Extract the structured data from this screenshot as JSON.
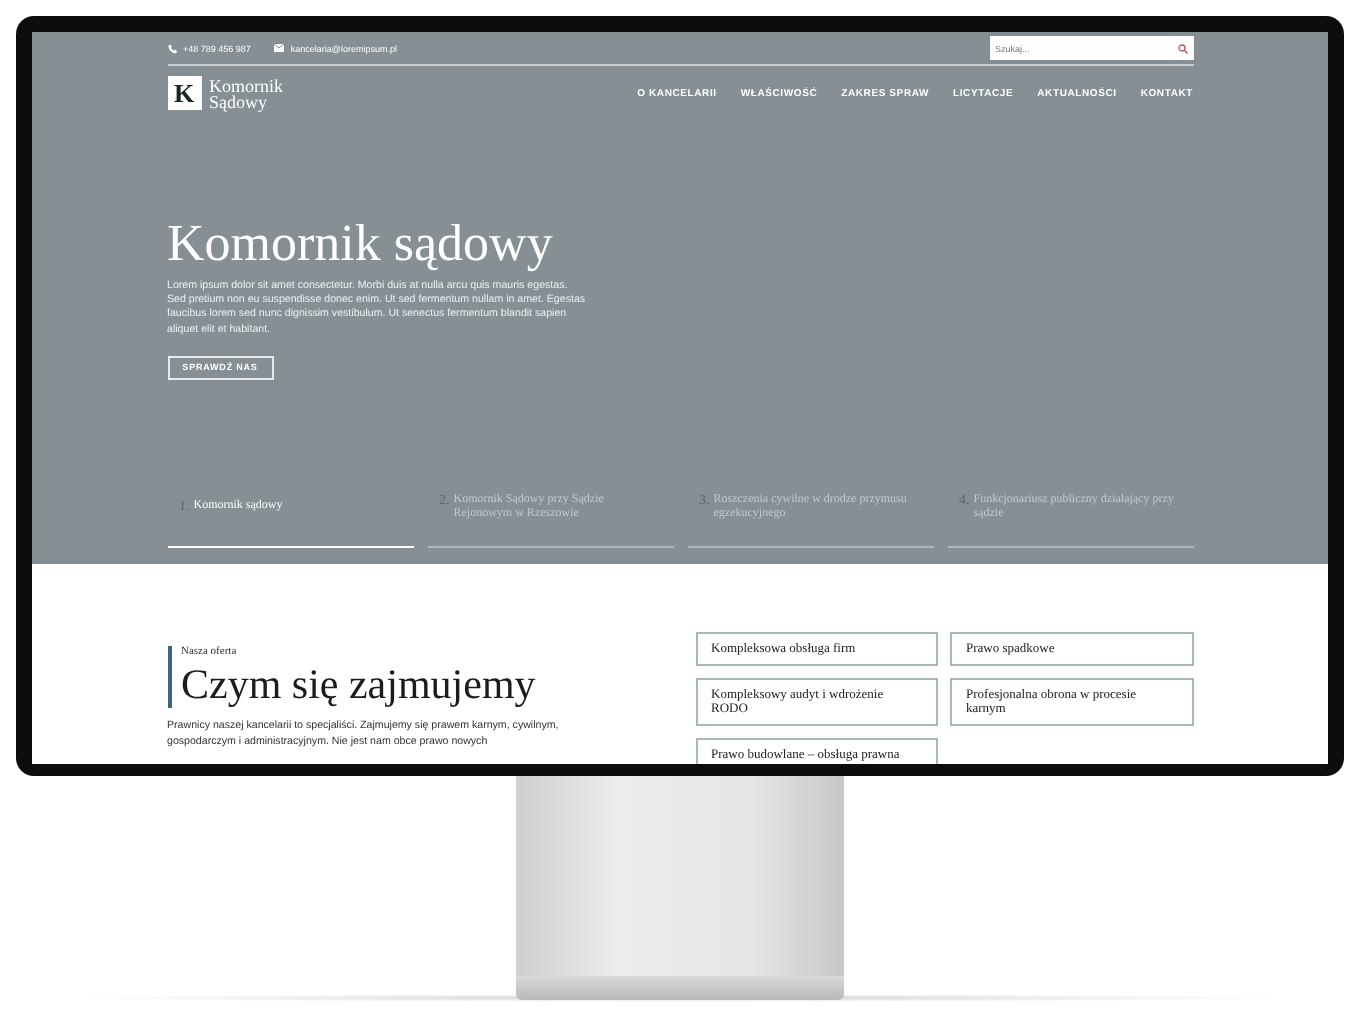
{
  "topbar": {
    "phone": "+48 789 456 987",
    "email": "kancelaria@loremipsum.pl",
    "search": {
      "placeholder": "Szukaj..."
    }
  },
  "logo": {
    "letter": "K",
    "line_1": "Komornik",
    "line_2": "Sądowy"
  },
  "nav": [
    {
      "label": "O KANCELARII"
    },
    {
      "label": "WŁAŚCIWOŚĆ"
    },
    {
      "label": "ZAKRES SPRAW"
    },
    {
      "label": "LICYTACJE"
    },
    {
      "label": "AKTUALNOŚCI"
    },
    {
      "label": "KONTAKT"
    }
  ],
  "hero": {
    "title": "Komornik sądowy",
    "text": "Lorem ipsum dolor sit amet consectetur. Morbi duis at nulla arcu quis mauris egestas. Sed pretium non eu suspendisse donec enim. Ut sed fermentum nullam in amet. Egestas faucibus lorem sed nunc dignissim vestibulum. Ut senectus fermentum blandit sapien aliquet elit et habitant.",
    "button": "SPRAWDŹ NAS"
  },
  "steps": [
    {
      "number": "1.",
      "label": "Komornik sądowy",
      "selected": true
    },
    {
      "number": "2.",
      "label": "Komornik Sądowy przy Sądzie Rejonowym w Rzeszowie",
      "selected": false
    },
    {
      "number": "3.",
      "label": "Roszczenia cywilne w drodze przymusu egzekucyjnego",
      "selected": false
    },
    {
      "number": "4.",
      "label": "Funkcjonariusz publiczny działający przy sądzie",
      "selected": false
    }
  ],
  "offer": {
    "eyebrow": "Nasza oferta",
    "heading": "Czym się zajmujemy",
    "text": "Prawnicy naszej kancelarii to specjaliści. Zajmujemy się prawem karnym, cywilnym, gospodarczym i administracyjnym. Nie jest nam obce prawo nowych",
    "services": [
      {
        "label": "Kompleksowa obsługa firm"
      },
      {
        "label": "Prawo spadkowe"
      },
      {
        "label": "Kompleksowy audyt i wdrożenie RODO"
      },
      {
        "label": "Profesjonalna obrona w procesie karnym"
      },
      {
        "label": "Prawo budowlane – obsługa prawna"
      }
    ]
  }
}
